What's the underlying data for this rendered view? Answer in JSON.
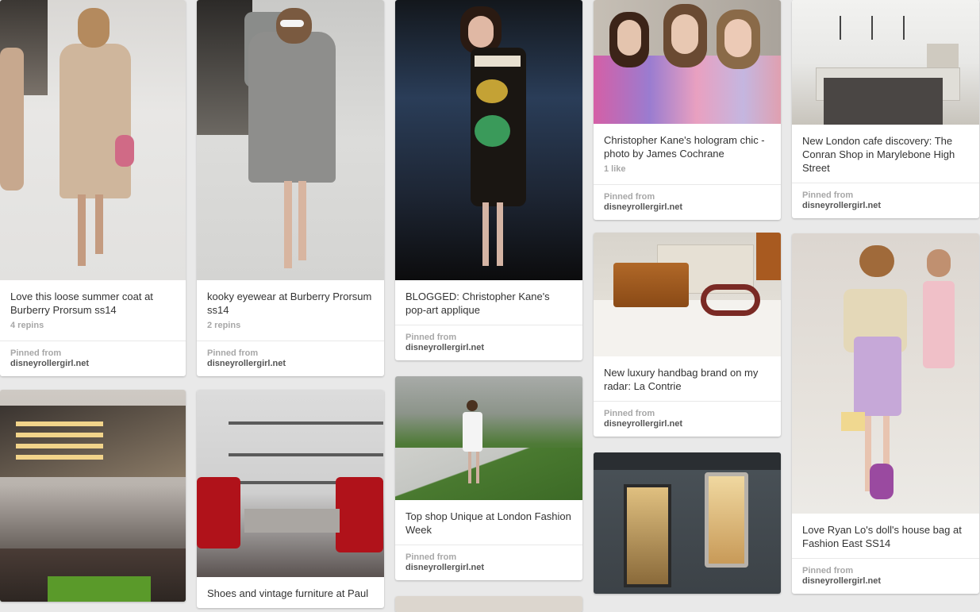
{
  "pins": [
    {
      "desc": "Love this loose summer coat at Burberry Prorsum ss14",
      "meta": "4 repins",
      "pinned_label": "Pinned from",
      "domain": "disneyrollergirl.net"
    },
    {
      "desc": "kooky eyewear at Burberry Prorsum ss14",
      "meta": "2 repins",
      "pinned_label": "Pinned from",
      "domain": "disneyrollergirl.net"
    },
    {
      "desc": "BLOGGED: Christopher Kane's pop-art applique",
      "pinned_label": "Pinned from",
      "domain": "disneyrollergirl.net"
    },
    {
      "desc": "Christopher Kane's hologram chic - photo by James Cochrane",
      "meta": "1 like",
      "pinned_label": "Pinned from",
      "domain": "disneyrollergirl.net"
    },
    {
      "desc": "New London cafe discovery: The Conran Shop in Marylebone High Street",
      "pinned_label": "Pinned from",
      "domain": "disneyrollergirl.net"
    },
    {
      "desc": "New luxury handbag brand on my radar: La Contrie",
      "pinned_label": "Pinned from",
      "domain": "disneyrollergirl.net"
    },
    {
      "desc": "Top shop Unique at London Fashion Week",
      "pinned_label": "Pinned from",
      "domain": "disneyrollergirl.net"
    },
    {
      "desc": "Love Ryan Lo's doll's house bag at Fashion East SS14",
      "pinned_label": "Pinned from",
      "domain": "disneyrollergirl.net"
    },
    {
      "desc": "Shoes and vintage furniture at Paul"
    }
  ]
}
